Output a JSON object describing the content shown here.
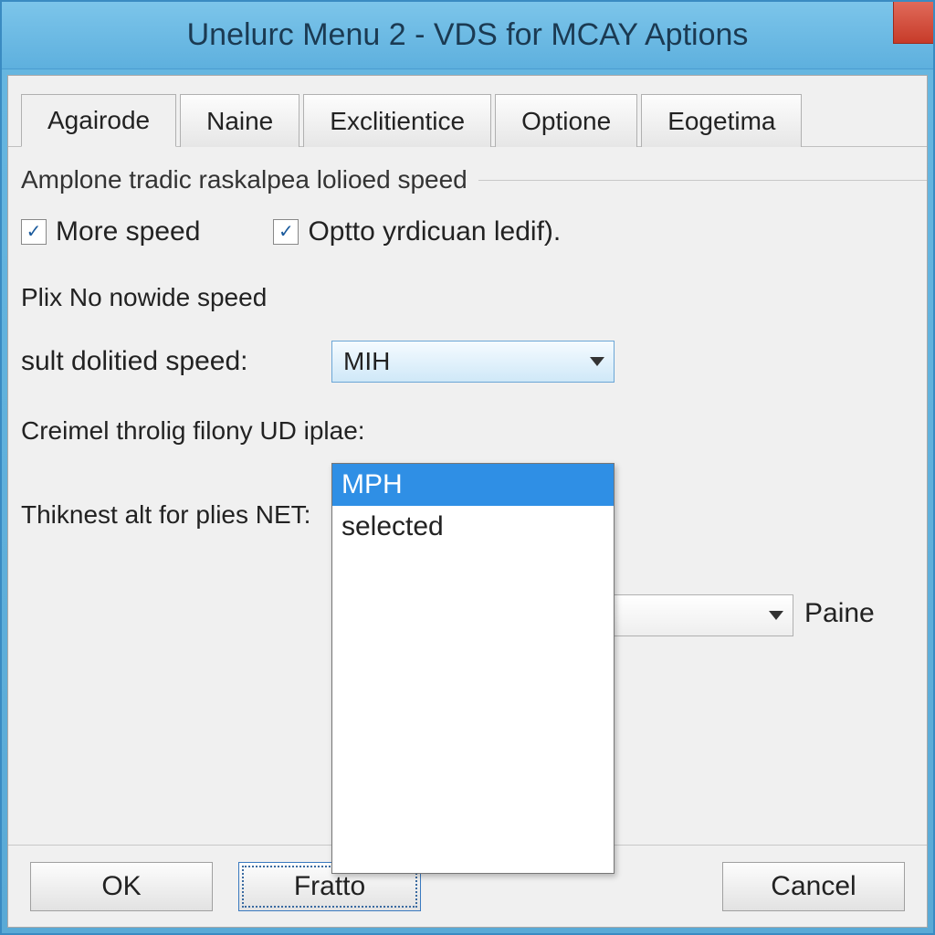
{
  "window": {
    "title": "Unelurc Menu 2 - VDS for MCAY Aptions"
  },
  "tabs": [
    {
      "label": "Agairode",
      "active": true
    },
    {
      "label": "Naine",
      "active": false
    },
    {
      "label": "Exclitientice",
      "active": false
    },
    {
      "label": "Optione",
      "active": false
    },
    {
      "label": "Eogetima",
      "active": false
    }
  ],
  "group1_label": "Amplone tradic raskalpea lolioed speed",
  "checkbox1": {
    "label": "More speed",
    "checked": true
  },
  "checkbox2": {
    "label": "Optto yrdicuan ledif).",
    "checked": true
  },
  "section2_label": "Plix No nowide speed",
  "speed_field": {
    "label": "sult dolitied speed:",
    "selected": "MIH",
    "options": [
      "MPH",
      "selected"
    ]
  },
  "line_creimel": "Creimel throlig filony UD iplae:",
  "thiknest_label": "Thiknest alt for plies NET:",
  "combo2": {
    "selected": "",
    "trailing_label": "Paine"
  },
  "buttons": {
    "ok": "OK",
    "fratto": "Fratto",
    "cancel": "Cancel"
  }
}
